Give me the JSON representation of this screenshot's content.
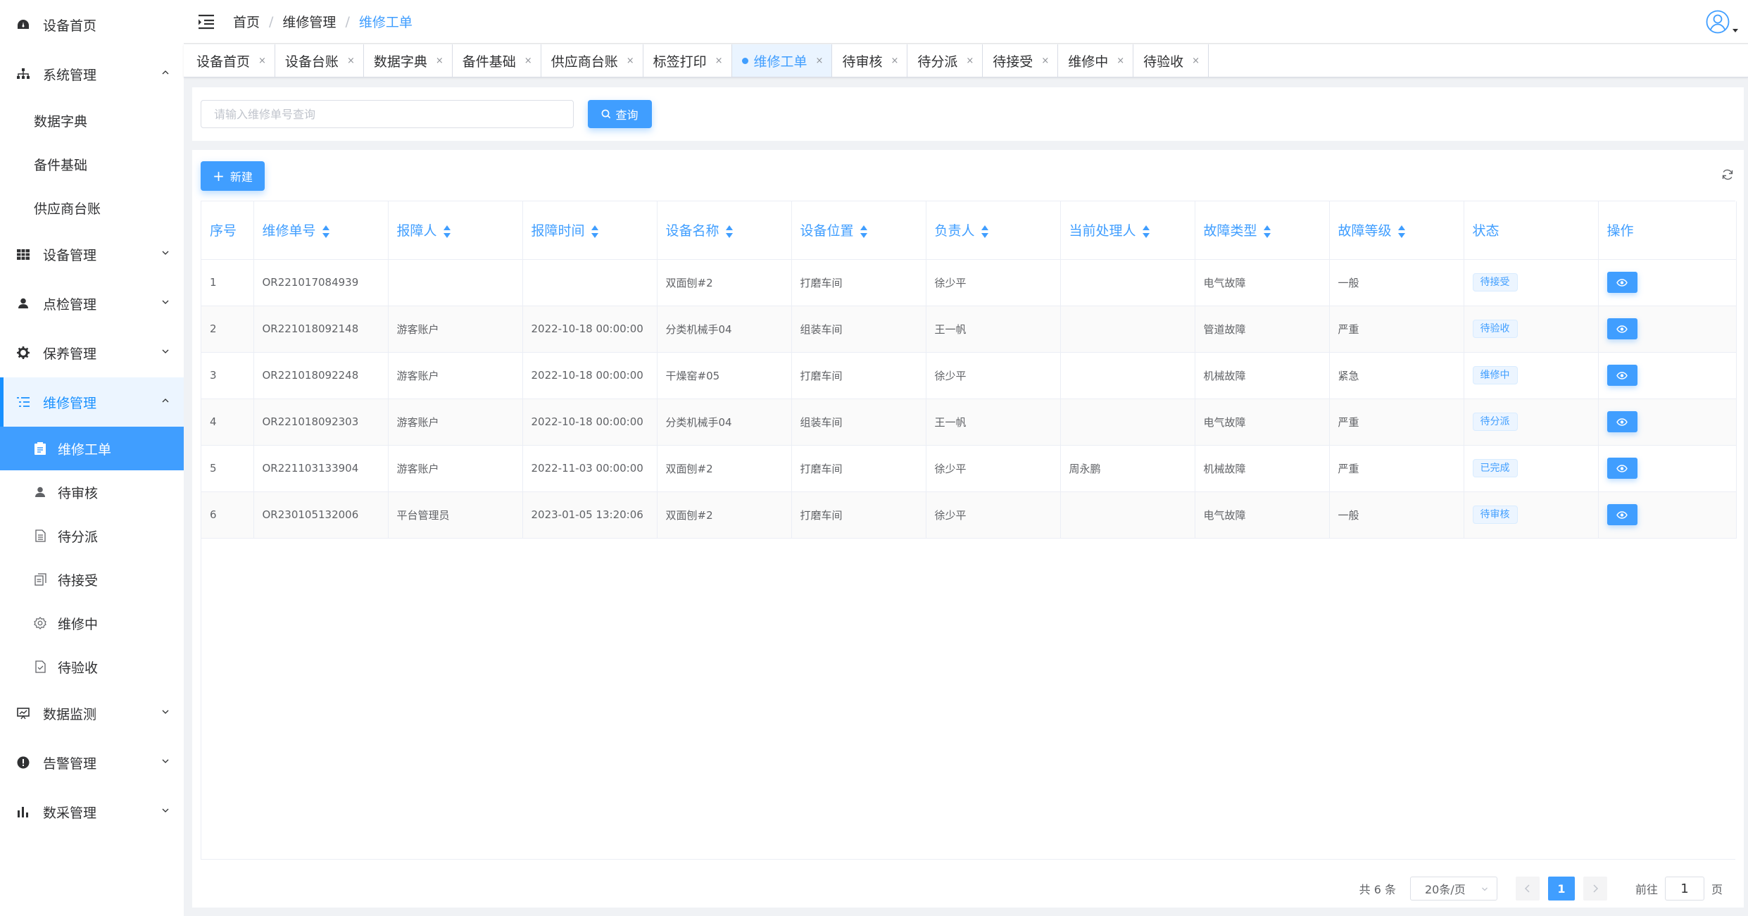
{
  "sidebar": {
    "items": [
      {
        "label": "设备首页",
        "icon": "dashboard-icon"
      },
      {
        "label": "系统管理",
        "icon": "sitemap-icon",
        "expanded": true,
        "children": [
          "数据字典",
          "备件基础",
          "供应商台账"
        ]
      },
      {
        "label": "设备管理",
        "icon": "table-icon"
      },
      {
        "label": "点检管理",
        "icon": "user-icon"
      },
      {
        "label": "保养管理",
        "icon": "gear-icon"
      },
      {
        "label": "维修管理",
        "icon": "list-icon",
        "expanded": true,
        "children": [
          {
            "label": "维修工单",
            "icon": "clipboard-icon"
          },
          {
            "label": "待审核",
            "icon": "person-icon"
          },
          {
            "label": "待分派",
            "icon": "document-icon"
          },
          {
            "label": "待接受",
            "icon": "copy-icon"
          },
          {
            "label": "维修中",
            "icon": "cog-icon"
          },
          {
            "label": "待验收",
            "icon": "check-document-icon"
          }
        ]
      },
      {
        "label": "数据监测",
        "icon": "monitor-icon"
      },
      {
        "label": "告警管理",
        "icon": "alert-icon"
      },
      {
        "label": "数采管理",
        "icon": "bar-chart-icon"
      }
    ]
  },
  "header": {
    "breadcrumb": [
      "首页",
      "维修管理",
      "维修工单"
    ],
    "breadcrumb_separator": "/"
  },
  "tags": [
    {
      "label": "设备首页",
      "active": false
    },
    {
      "label": "设备台账",
      "active": false
    },
    {
      "label": "数据字典",
      "active": false
    },
    {
      "label": "备件基础",
      "active": false
    },
    {
      "label": "供应商台账",
      "active": false
    },
    {
      "label": "标签打印",
      "active": false
    },
    {
      "label": "维修工单",
      "active": true
    },
    {
      "label": "待审核",
      "active": false
    },
    {
      "label": "待分派",
      "active": false
    },
    {
      "label": "待接受",
      "active": false
    },
    {
      "label": "维修中",
      "active": false
    },
    {
      "label": "待验收",
      "active": false
    }
  ],
  "tag_close": "×",
  "search": {
    "placeholder": "请输入维修单号查询",
    "value": "",
    "button_label": "查询"
  },
  "toolbar": {
    "new_label": "新建"
  },
  "table": {
    "columns": [
      "序号",
      "维修单号",
      "报障人",
      "报障时间",
      "设备名称",
      "设备位置",
      "负责人",
      "当前处理人",
      "故障类型",
      "故障等级",
      "状态",
      "操作"
    ],
    "rows": [
      {
        "index": "1",
        "order_no": "OR221017084939",
        "reporter": "",
        "report_time": "",
        "device_name": "双面刨#2",
        "location": "打磨车间",
        "owner": "徐少平",
        "handler": "",
        "fault_type": "电气故障",
        "fault_level": "一般",
        "status": "待接受"
      },
      {
        "index": "2",
        "order_no": "OR221018092148",
        "reporter": "游客账户",
        "report_time": "2022-10-18 00:00:00",
        "device_name": "分类机械手04",
        "location": "组装车间",
        "owner": "王一帆",
        "handler": "",
        "fault_type": "管道故障",
        "fault_level": "严重",
        "status": "待验收"
      },
      {
        "index": "3",
        "order_no": "OR221018092248",
        "reporter": "游客账户",
        "report_time": "2022-10-18 00:00:00",
        "device_name": "干燥窑#05",
        "location": "打磨车间",
        "owner": "徐少平",
        "handler": "",
        "fault_type": "机械故障",
        "fault_level": "紧急",
        "status": "维修中"
      },
      {
        "index": "4",
        "order_no": "OR221018092303",
        "reporter": "游客账户",
        "report_time": "2022-10-18 00:00:00",
        "device_name": "分类机械手04",
        "location": "组装车间",
        "owner": "王一帆",
        "handler": "",
        "fault_type": "电气故障",
        "fault_level": "严重",
        "status": "待分派"
      },
      {
        "index": "5",
        "order_no": "OR221103133904",
        "reporter": "游客账户",
        "report_time": "2022-11-03 00:00:00",
        "device_name": "双面刨#2",
        "location": "打磨车间",
        "owner": "徐少平",
        "handler": "周永鹏",
        "fault_type": "机械故障",
        "fault_level": "严重",
        "status": "已完成"
      },
      {
        "index": "6",
        "order_no": "OR230105132006",
        "reporter": "平台管理员",
        "report_time": "2023-01-05 13:20:06",
        "device_name": "双面刨#2",
        "location": "打磨车间",
        "owner": "徐少平",
        "handler": "",
        "fault_type": "电气故障",
        "fault_level": "一般",
        "status": "待审核"
      }
    ]
  },
  "pagination": {
    "total_text": "共 6 条",
    "page_size": "20条/页",
    "current_page": "1",
    "jump_prefix": "前往",
    "jump_value": "1",
    "jump_suffix": "页"
  },
  "colors": {
    "primary": "#409eff",
    "sidebar_active_bg": "#409eff",
    "page_bg": "#f0f2f5"
  }
}
